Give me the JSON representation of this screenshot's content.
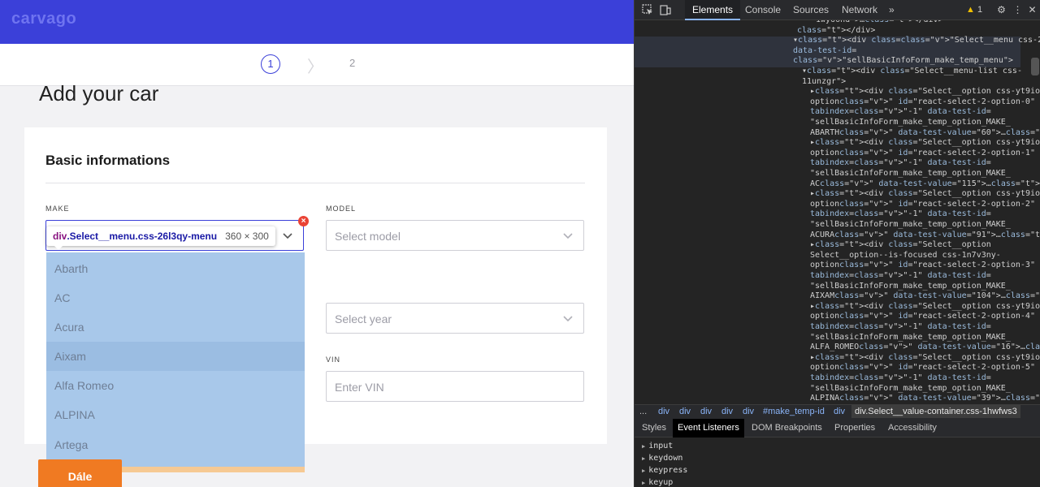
{
  "site": {
    "logo_text": "carvago",
    "stepper": {
      "step_current": "1",
      "step_next": "2",
      "chevron": "〉"
    },
    "page_title": "Add your car",
    "section_title": "Basic informations",
    "fields": {
      "make_label": "MAKE",
      "model_label": "MODEL",
      "model_placeholder": "Select model",
      "year_placeholder": "Select year",
      "vin_label": "VIN",
      "vin_placeholder": "Enter VIN"
    },
    "make_menu_options": [
      "Abarth",
      "AC",
      "Acura",
      "Aixam",
      "Alfa Romeo",
      "ALPINA",
      "Artega"
    ],
    "focused_option": "Aixam",
    "cta_label": "Dále"
  },
  "inspector_tooltip": {
    "tag": "div",
    "class_name": ".Select__menu.css-26l3qy-menu",
    "dimensions": "360 × 300"
  },
  "devtools": {
    "tabs": [
      "Elements",
      "Console",
      "Sources",
      "Network"
    ],
    "active_tab": "Elements",
    "more_tabs": "»",
    "warning_count": "1",
    "dom_lines": [
      "1wy6ond\">…</div>",
      "</div>",
      "▾<div class=\"Select__menu css-26l3qy-menu\"",
      "data-test-id=",
      "\"sellBasicInfoForm_make_temp_menu\">",
      "▾<div class=\"Select__menu-list css-",
      "11unzgr\">",
      "▸<div class=\"Select__option css-yt9ioa-",
      "option\" id=\"react-select-2-option-0\"",
      "tabindex=\"-1\" data-test-id=",
      "\"sellBasicInfoForm_make_temp_option_MAKE_",
      "ABARTH\" data-test-value=\"60\">…</div>",
      "▸<div class=\"Select__option css-yt9ioa-",
      "option\" id=\"react-select-2-option-1\"",
      "tabindex=\"-1\" data-test-id=",
      "\"sellBasicInfoForm_make_temp_option_MAKE_",
      "AC\" data-test-value=\"115\">…</div>",
      "▸<div class=\"Select__option css-yt9ioa-",
      "option\" id=\"react-select-2-option-2\"",
      "tabindex=\"-1\" data-test-id=",
      "\"sellBasicInfoForm_make_temp_option_MAKE_",
      "ACURA\" data-test-value=\"91\">…</div>",
      "▸<div class=\"Select__option",
      "Select__option--is-focused css-1n7v3ny-",
      "option\" id=\"react-select-2-option-3\"",
      "tabindex=\"-1\" data-test-id=",
      "\"sellBasicInfoForm_make_temp_option_MAKE_",
      "AIXAM\" data-test-value=\"104\">…</div>",
      "▸<div class=\"Select__option css-yt9ioa-",
      "option\" id=\"react-select-2-option-4\"",
      "tabindex=\"-1\" data-test-id=",
      "\"sellBasicInfoForm_make_temp_option_MAKE_",
      "ALFA_ROMEO\" data-test-value=\"16\">…</div>",
      "▸<div class=\"Select__option css-yt9ioa-",
      "option\" id=\"react-select-2-option-5\"",
      "tabindex=\"-1\" data-test-id=",
      "\"sellBasicInfoForm_make_temp_option_MAKE_",
      "ALPINA\" data-test-value=\"39\">…</div>"
    ],
    "breadcrumbs": [
      "...",
      "div",
      "div",
      "div",
      "div",
      "div",
      "#make_temp-id",
      "div",
      "div.Select__value-container.css-1hwfws3"
    ],
    "panel_tabs": [
      "Styles",
      "Event Listeners",
      "DOM Breakpoints",
      "Properties",
      "Accessibility"
    ],
    "active_panel_tab": "Event Listeners",
    "event_listeners": [
      "input",
      "keydown",
      "keypress",
      "keyup"
    ]
  },
  "colors": {
    "brand_blue": "#3b40d9",
    "cta_orange": "#f07a22",
    "menu_highlight": "#a8c8ea",
    "devtools_bg": "#242424"
  }
}
